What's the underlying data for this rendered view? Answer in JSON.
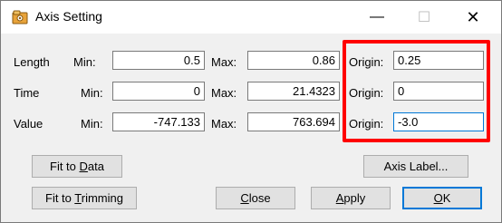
{
  "window": {
    "title": "Axis Setting",
    "minimize_glyph": "—",
    "maximize_glyph": "☐",
    "close_glyph": "✕"
  },
  "rows": [
    {
      "name": "Length",
      "min_label": "Min:",
      "min": "0.5",
      "max_label": "Max:",
      "max": "0.86",
      "origin_label": "Origin:",
      "origin": "0.25"
    },
    {
      "name": "Time",
      "min_label": "Min:",
      "min": "0",
      "max_label": "Max:",
      "max": "21.4323",
      "origin_label": "Origin:",
      "origin": "0"
    },
    {
      "name": "Value",
      "min_label": "Min:",
      "min": "-747.133",
      "max_label": "Max:",
      "max": "763.694",
      "origin_label": "Origin:",
      "origin": "-3.0"
    }
  ],
  "buttons": {
    "fit_to_data": {
      "pre": "Fit to ",
      "accel": "D",
      "post": "ata"
    },
    "axis_label": {
      "pre": "Axis Label...",
      "accel": "",
      "post": ""
    },
    "fit_to_trimming": {
      "pre": "Fit to ",
      "accel": "T",
      "post": "rimming"
    },
    "close": {
      "pre": "",
      "accel": "C",
      "post": "lose"
    },
    "apply": {
      "pre": "",
      "accel": "A",
      "post": "pply"
    },
    "ok": {
      "pre": "",
      "accel": "O",
      "post": "K"
    }
  },
  "colors": {
    "highlight": "#ff0000",
    "focus": "#0078d7"
  },
  "icons": {
    "app": "axis-setting-app-icon"
  }
}
